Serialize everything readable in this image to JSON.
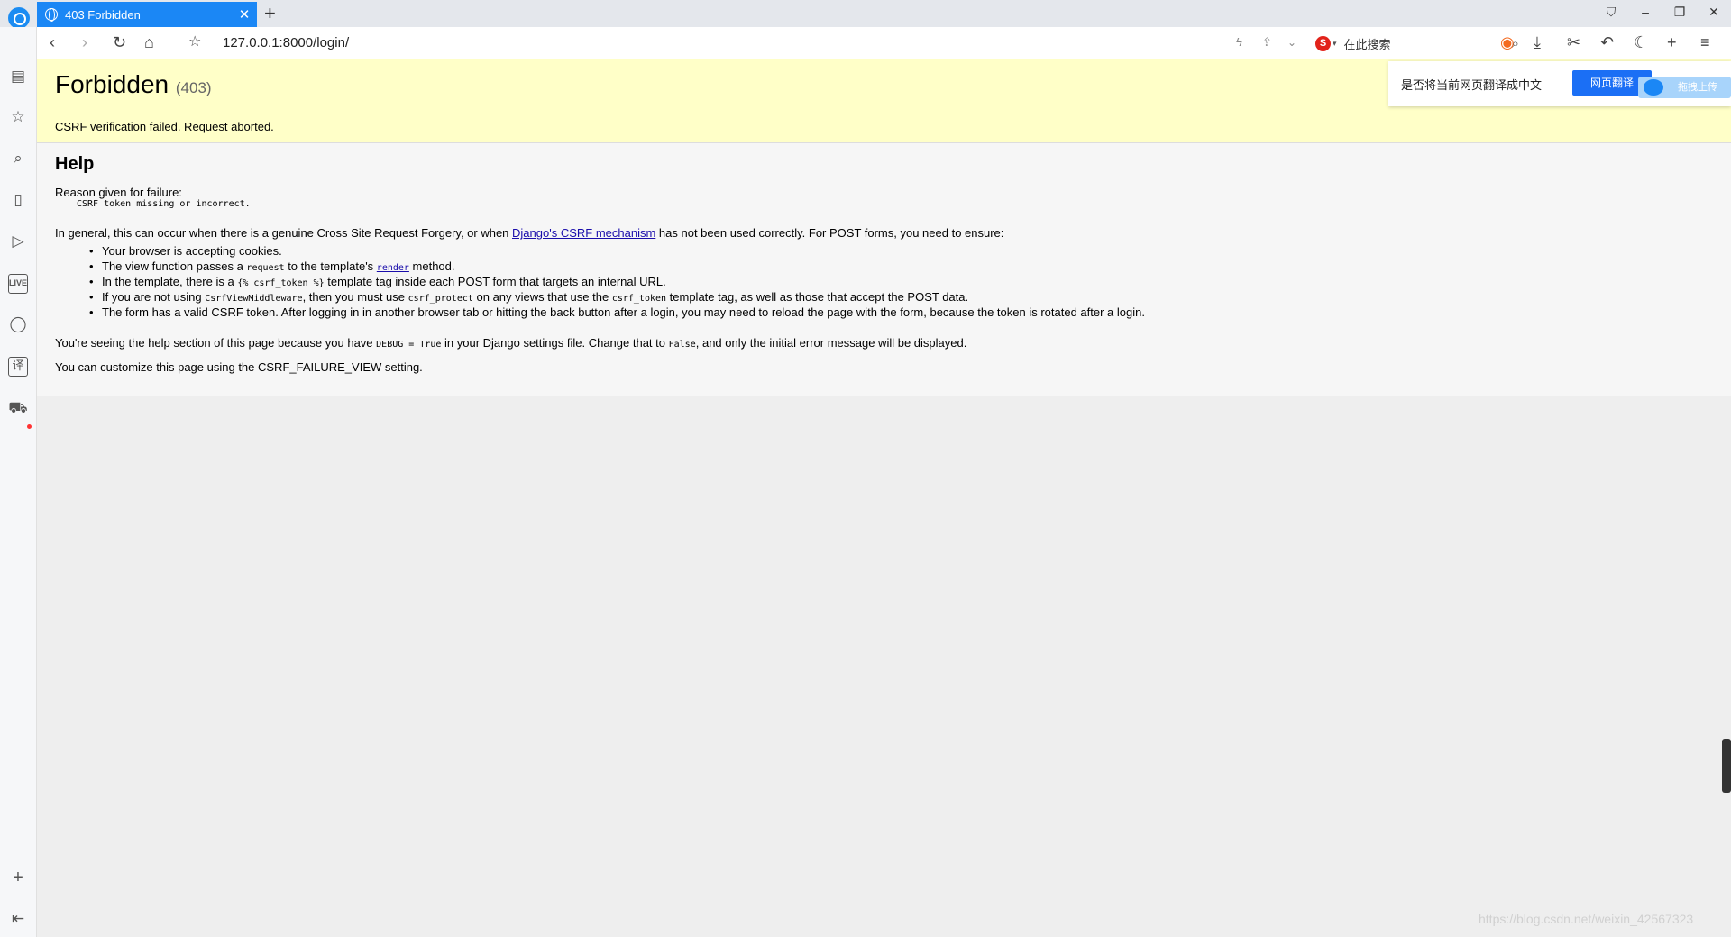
{
  "browser": {
    "tab_title": "403 Forbidden",
    "tab_close": "✕",
    "new_tab": "+",
    "url": "127.0.0.1:8000/login/",
    "search_placeholder": "在此搜索",
    "search_engine_glyph": "S",
    "icons": [
      "back-icon",
      "forward-icon",
      "reload-icon",
      "home-icon",
      "star-icon",
      "flash-icon",
      "share-icon",
      "dropdown-icon",
      "game-icon",
      "download-icon",
      "scissors-icon",
      "undo-icon",
      "moon-icon",
      "add-icon",
      "menu-icon"
    ]
  },
  "sidebar": {
    "icons": [
      "news-icon",
      "favorites-icon",
      "search-icon",
      "book-icon",
      "video-icon",
      "live-icon",
      "chat-icon",
      "translate-icon",
      "cart-icon",
      "add-icon",
      "collapse-icon"
    ],
    "live_label": "LIVE",
    "translate_glyph": "译"
  },
  "error": {
    "title": "Forbidden",
    "code": "(403)",
    "message": "CSRF verification failed. Request aborted."
  },
  "help": {
    "heading": "Help",
    "reason_label": "Reason given for failure:",
    "reason": "CSRF token missing or incorrect.",
    "general_1": "In general, this can occur when there is a genuine Cross Site Request Forgery, or when ",
    "general_link": "Django's CSRF mechanism",
    "general_2": " has not been used correctly. For POST forms, you need to ensure:",
    "items": {
      "i1": "Your browser is accepting cookies.",
      "i2a": "The view function passes a ",
      "i2code": "request",
      "i2b": " to the template's ",
      "i2link": "render",
      "i2c": " method.",
      "i3a": "In the template, there is a ",
      "i3code": "{% csrf_token %}",
      "i3b": " template tag inside each POST form that targets an internal URL.",
      "i4a": "If you are not using ",
      "i4code1": "CsrfViewMiddleware",
      "i4b": ", then you must use ",
      "i4code2": "csrf_protect",
      "i4c": " on any views that use the ",
      "i4code3": "csrf_token",
      "i4d": " template tag, as well as those that accept the POST data.",
      "i5": "The form has a valid CSRF token. After logging in in another browser tab or hitting the back button after a login, you may need to reload the page with the form, because the token is rotated after a login."
    },
    "debug_1": "You're seeing the help section of this page because you have ",
    "debug_code": "DEBUG = True",
    "debug_2": " in your Django settings file. Change that to ",
    "debug_code2": "False",
    "debug_3": ", and only the initial error message will be displayed.",
    "customize": "You can customize this page using the CSRF_FAILURE_VIEW setting."
  },
  "translate_popup": {
    "question": "是否将当前网页翻译成中文",
    "button": "网页翻译",
    "upload": "拖拽上传"
  },
  "watermark": "https://blog.csdn.net/weixin_42567323",
  "colors": {
    "tab_blue": "#1b87f5",
    "summary_bg": "#ffffc8",
    "link": "#1a0dab"
  }
}
